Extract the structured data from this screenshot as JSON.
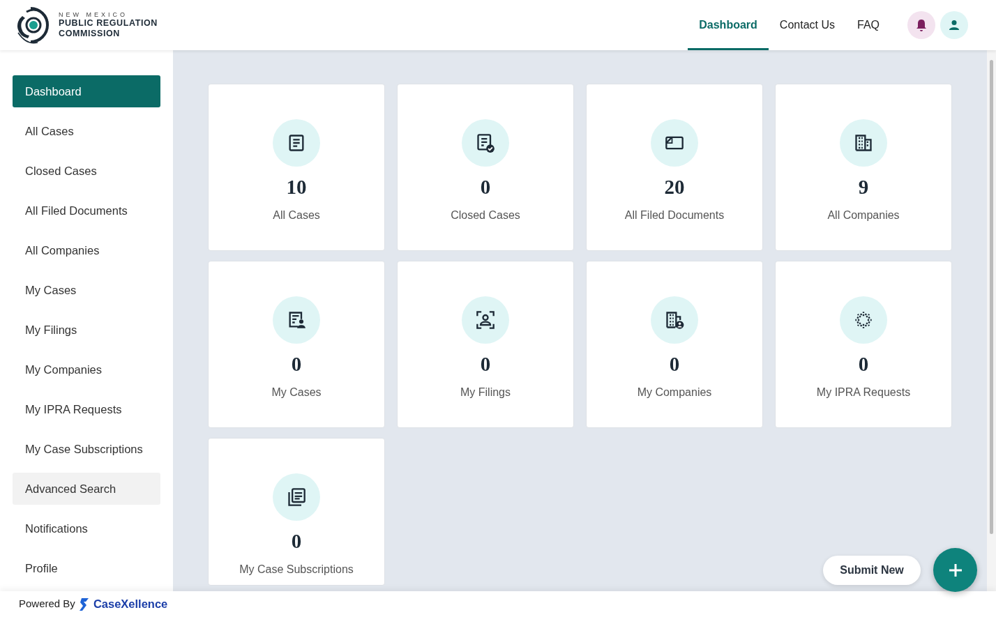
{
  "logo": {
    "line_1": "NEW MEXICO",
    "line_2": "PUBLIC REGULATION",
    "line_3": "COMMISSION"
  },
  "top_nav": [
    {
      "label": "Dashboard",
      "selected": true
    },
    {
      "label": "Contact Us",
      "selected": false
    },
    {
      "label": "FAQ",
      "selected": false
    }
  ],
  "sidebar": {
    "items": [
      {
        "label": "Dashboard",
        "selected": true,
        "highlighted": false
      },
      {
        "label": "All Cases",
        "selected": false,
        "highlighted": false
      },
      {
        "label": "Closed Cases",
        "selected": false,
        "highlighted": false
      },
      {
        "label": "All Filed Documents",
        "selected": false,
        "highlighted": false
      },
      {
        "label": "All Companies",
        "selected": false,
        "highlighted": false
      },
      {
        "label": "My Cases",
        "selected": false,
        "highlighted": false
      },
      {
        "label": "My Filings",
        "selected": false,
        "highlighted": false
      },
      {
        "label": "My Companies",
        "selected": false,
        "highlighted": false
      },
      {
        "label": "My IPRA Requests",
        "selected": false,
        "highlighted": false
      },
      {
        "label": "My Case Subscriptions",
        "selected": false,
        "highlighted": false
      },
      {
        "label": "Advanced Search",
        "selected": false,
        "highlighted": true
      },
      {
        "label": "Notifications",
        "selected": false,
        "highlighted": false
      },
      {
        "label": "Profile",
        "selected": false,
        "highlighted": false
      }
    ]
  },
  "tiles": [
    {
      "kind": "document",
      "count": "10",
      "label": "All Cases"
    },
    {
      "kind": "document-check",
      "count": "0",
      "label": "Closed Cases"
    },
    {
      "kind": "folder",
      "count": "20",
      "label": "All Filed Documents"
    },
    {
      "kind": "building",
      "count": "9",
      "label": "All Companies"
    },
    {
      "kind": "document-person",
      "count": "0",
      "label": "My Cases"
    },
    {
      "kind": "person-frame",
      "count": "0",
      "label": "My Filings"
    },
    {
      "kind": "building-person",
      "count": "0",
      "label": "My Companies"
    },
    {
      "kind": "burst",
      "count": "0",
      "label": "My IPRA Requests"
    },
    {
      "kind": "documents",
      "count": "0",
      "label": "My Case Subscriptions"
    }
  ],
  "submit_button": {
    "tooltip": "Submit New"
  },
  "footer": {
    "powered_by": "Powered By",
    "brand": "CaseXellence"
  }
}
